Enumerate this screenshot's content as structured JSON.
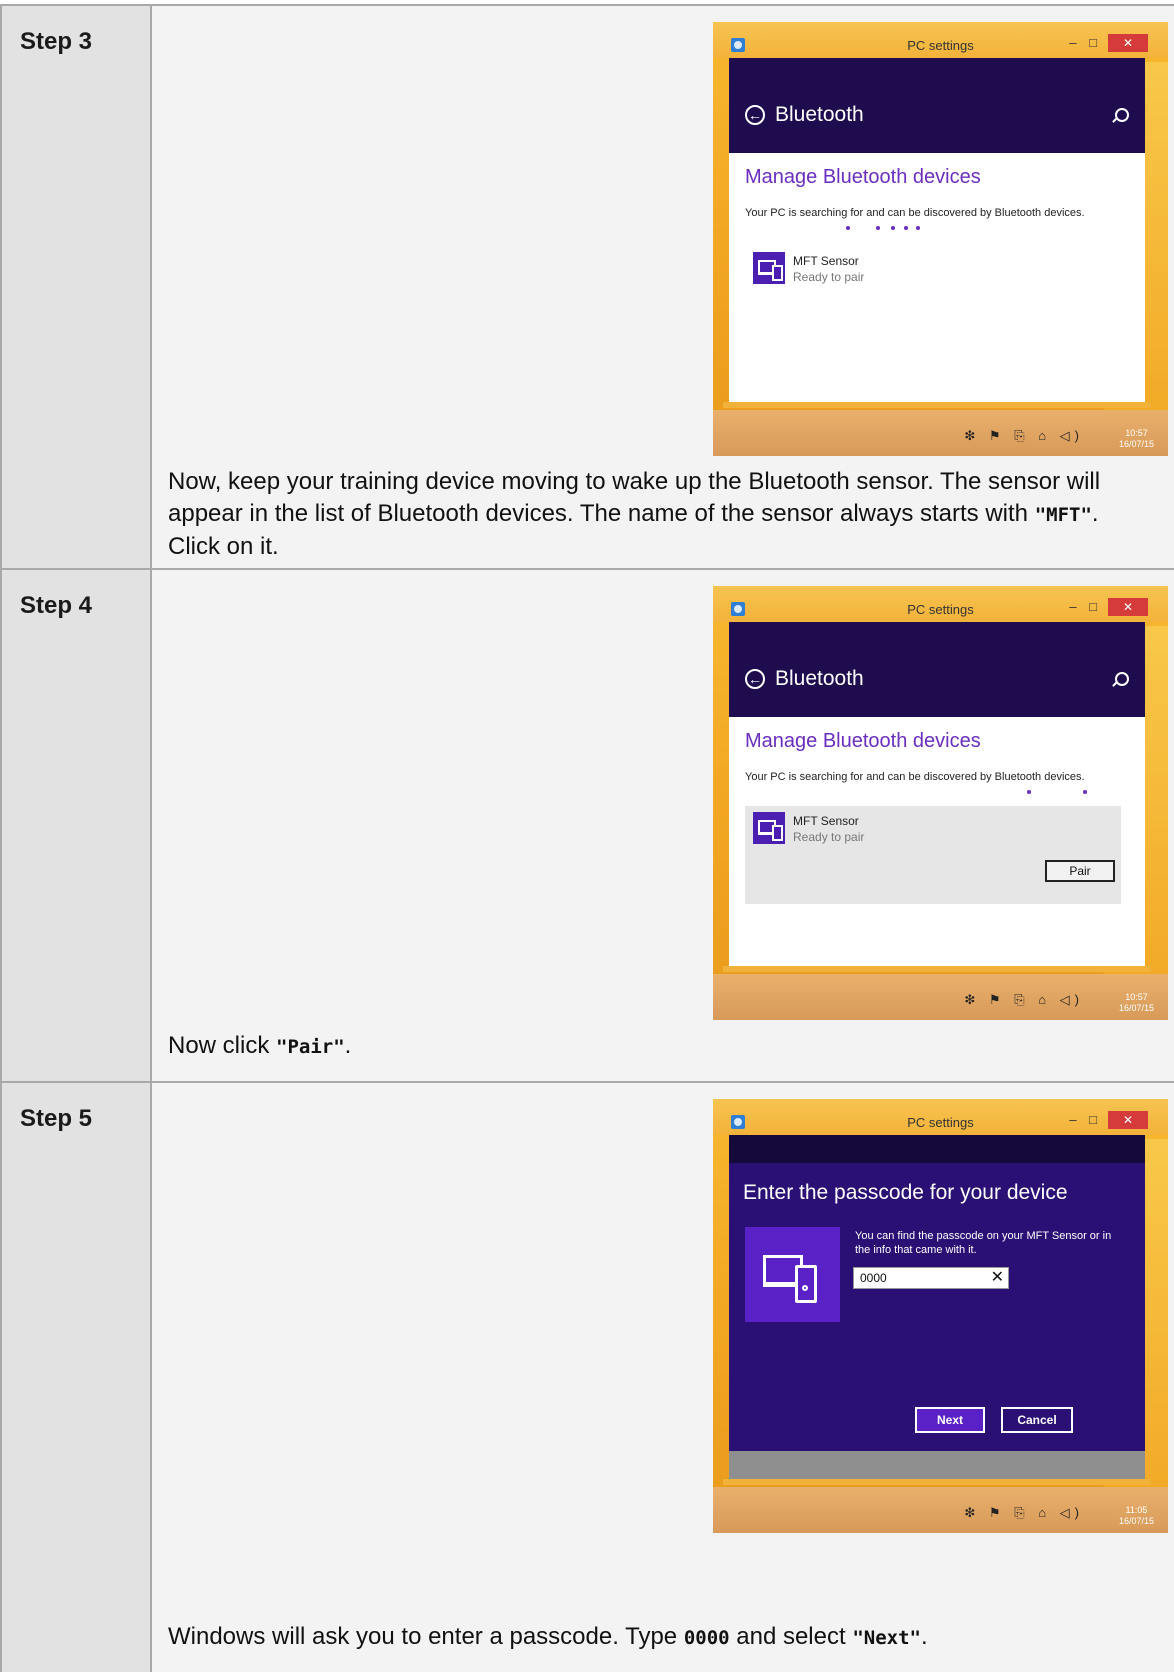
{
  "window": {
    "title": "PC settings",
    "minimize_glyph": "–",
    "maximize_glyph": "□",
    "close_glyph": "✕",
    "back_glyph": "←",
    "clear_glyph": "✕"
  },
  "bluetooth": {
    "header": "Bluetooth",
    "manage_title": "Manage Bluetooth devices",
    "searching_text": "Your PC is searching for and can be discovered by Bluetooth devices.",
    "device_name": "MFT Sensor",
    "device_status": "Ready to pair",
    "pair_label": "Pair"
  },
  "passcode_dialog": {
    "title": "Enter the passcode for your device",
    "help_text": "You can find the passcode on your MFT Sensor or in the info that came with it.",
    "input_value": "0000",
    "next_label": "Next",
    "cancel_label": "Cancel"
  },
  "taskbar": {
    "tray_icons": [
      "bluetooth-icon",
      "flag-icon",
      "network-icon",
      "power-icon",
      "volume-icon"
    ],
    "tray_glyphs": "❇ ⚑ ⎘ ⌂ ◁)"
  },
  "steps": [
    {
      "label": "Step 3",
      "clock_time": "10:57",
      "clock_date": "16/07/15",
      "desc_1": "Now, keep your training device moving to wake up the Bluetooth sensor. The sensor will appear in the list of Bluetooth devices. The name of the sensor always starts with ",
      "desc_code": "\"MFT\"",
      "desc_2": ". Click on it."
    },
    {
      "label": "Step 4",
      "clock_time": "10:57",
      "clock_date": "16/07/15",
      "desc_1": "Now click ",
      "desc_code": "\"Pair\"",
      "desc_2": "."
    },
    {
      "label": "Step 5",
      "clock_time": "11:05",
      "clock_date": "16/07/15",
      "desc_1": "Windows will ask you to enter a passcode. Type ",
      "desc_code": "0000",
      "desc_2": " and select ",
      "desc_code_2": "\"Next\"",
      "desc_3": "."
    }
  ]
}
